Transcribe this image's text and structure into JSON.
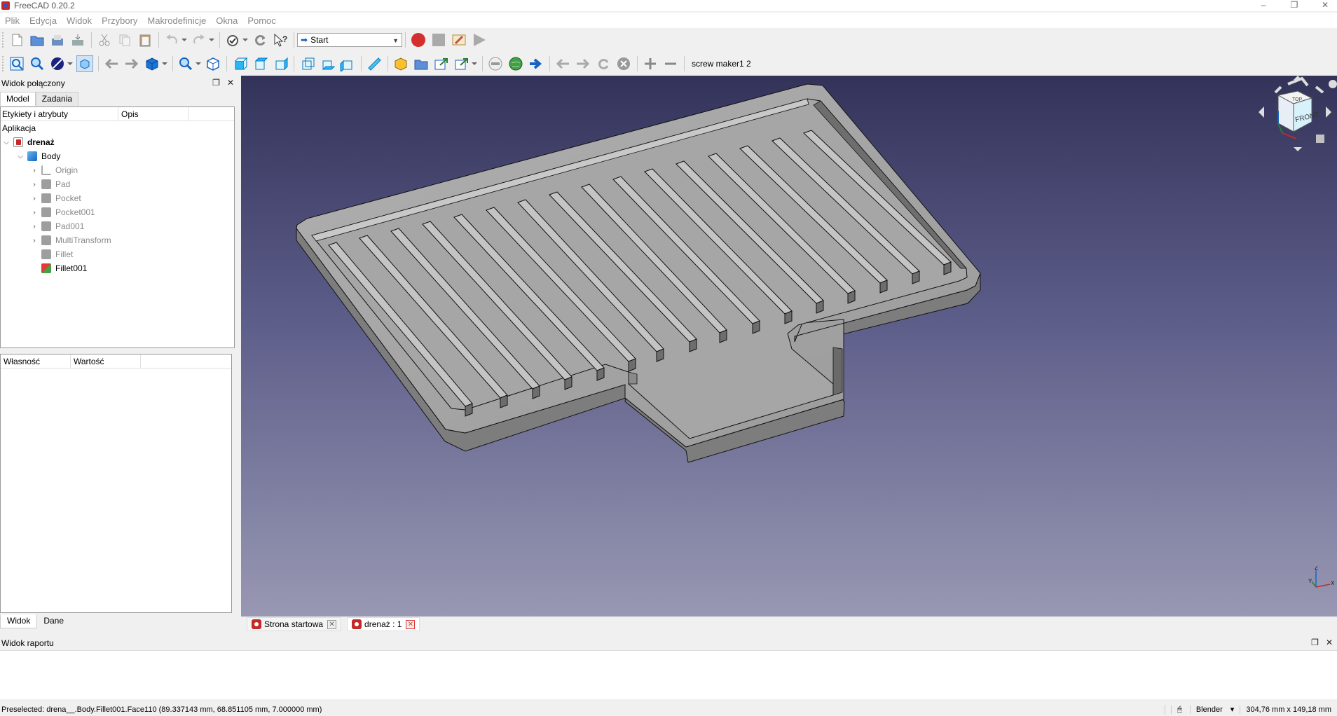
{
  "window": {
    "title": "FreeCAD 0.20.2",
    "controls": [
      "–",
      "❐",
      "✕"
    ]
  },
  "menu": [
    "Plik",
    "Edycja",
    "Widok",
    "Przybory",
    "Makrodefinicje",
    "Okna",
    "Pomoc"
  ],
  "toolbar": {
    "workbench": "Start",
    "macro_label": "screw maker1 2"
  },
  "combo_view": {
    "title": "Widok połączony",
    "tabs": [
      "Model",
      "Zadania"
    ],
    "tree_headers": [
      "Etykiety i atrybuty",
      "Opis"
    ],
    "application_label": "Aplikacja",
    "tree": [
      {
        "label": "drenaż",
        "level": 0,
        "expanded": true,
        "bold": true,
        "icon": "document-icon"
      },
      {
        "label": "Body",
        "level": 1,
        "expanded": true,
        "icon": "body-icon"
      },
      {
        "label": "Origin",
        "level": 2,
        "collapsed": true,
        "icon": "origin-icon"
      },
      {
        "label": "Pad",
        "level": 2,
        "collapsed": true,
        "icon": "pad-icon"
      },
      {
        "label": "Pocket",
        "level": 2,
        "collapsed": true,
        "icon": "pocket-icon"
      },
      {
        "label": "Pocket001",
        "level": 2,
        "collapsed": true,
        "icon": "pocket-icon"
      },
      {
        "label": "Pad001",
        "level": 2,
        "collapsed": true,
        "icon": "pad-icon"
      },
      {
        "label": "MultiTransform",
        "level": 2,
        "collapsed": true,
        "icon": "multitransform-icon"
      },
      {
        "label": "Fillet",
        "level": 2,
        "icon": "fillet-icon"
      },
      {
        "label": "Fillet001",
        "level": 2,
        "icon": "fillet-active-icon",
        "active": true
      }
    ],
    "prop_headers": [
      "Własność",
      "Wartość"
    ],
    "bottom_tabs": [
      "Widok",
      "Dane"
    ]
  },
  "navcube": {
    "face_label": "FRONT",
    "top_label": "TOP"
  },
  "axis": {
    "x": "X",
    "y": "Y",
    "z": "Z"
  },
  "doc_tabs": [
    {
      "label": "Strona startowa",
      "active": false
    },
    {
      "label": "drenaż : 1",
      "active": true
    }
  ],
  "report_view": {
    "title": "Widok raportu"
  },
  "status": {
    "preselected": "Preselected: drena__.Body.Fillet001.Face110 (89.337143 mm, 68.851105 mm, 7.000000 mm)",
    "navigation": "Blender",
    "dimensions": "304,76 mm x 149,18 mm"
  },
  "colors": {
    "viewport_top": "#33335a",
    "viewport_bottom": "#9898b3",
    "part_gray": "#a3a3a3",
    "record_red": "#d32f2f"
  }
}
